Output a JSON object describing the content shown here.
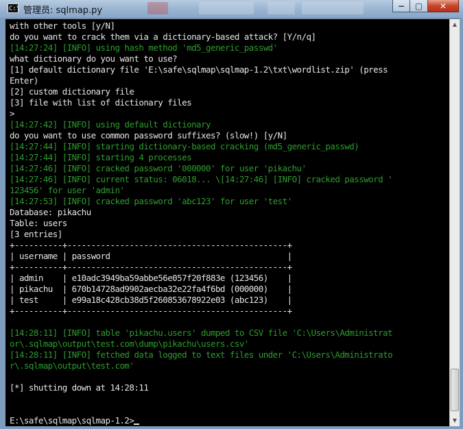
{
  "window": {
    "title": "管理员: sqlmap.py",
    "icon_name": "cmd-console-icon",
    "icon_glyph": "C:\\",
    "buttons": {
      "minimize": "−",
      "maximize": "▢",
      "close": "✕"
    }
  },
  "console": {
    "lines": [
      {
        "c": "w",
        "t": "with other tools [y/N]"
      },
      {
        "c": "w",
        "t": "do you want to crack them via a dictionary-based attack? [Y/n/q]"
      },
      {
        "c": "g",
        "t": "[14:27:24] [INFO] using hash method 'md5_generic_passwd'"
      },
      {
        "c": "w",
        "t": "what dictionary do you want to use?"
      },
      {
        "c": "w",
        "t": "[1] default dictionary file 'E:\\safe\\sqlmap\\sqlmap-1.2\\txt\\wordlist.zip' (press"
      },
      {
        "c": "w",
        "t": "Enter)"
      },
      {
        "c": "w",
        "t": "[2] custom dictionary file"
      },
      {
        "c": "w",
        "t": "[3] file with list of dictionary files"
      },
      {
        "c": "w",
        "t": ">"
      },
      {
        "c": "g",
        "t": "[14:27:42] [INFO] using default dictionary"
      },
      {
        "c": "w",
        "t": "do you want to use common password suffixes? (slow!) [y/N]"
      },
      {
        "c": "g",
        "t": "[14:27:44] [INFO] starting dictionary-based cracking (md5_generic_passwd)"
      },
      {
        "c": "g",
        "t": "[14:27:44] [INFO] starting 4 processes"
      },
      {
        "c": "g",
        "t": "[14:27:46] [INFO] cracked password '000000' for user 'pikachu'"
      },
      {
        "c": "g",
        "t": "[14:27:46] [INFO] current status: 06018... \\[14:27:46] [INFO] cracked password '"
      },
      {
        "c": "g",
        "t": "123456' for user 'admin'"
      },
      {
        "c": "g",
        "t": "[14:27:53] [INFO] cracked password 'abc123' for user 'test'"
      },
      {
        "c": "w",
        "t": "Database: pikachu"
      },
      {
        "c": "w",
        "t": "Table: users"
      },
      {
        "c": "w",
        "t": "[3 entries]"
      },
      {
        "c": "w",
        "t": "+----------+----------------------------------------------+"
      },
      {
        "c": "w",
        "t": "| username | password                                     |"
      },
      {
        "c": "w",
        "t": "+----------+----------------------------------------------+"
      },
      {
        "c": "w",
        "t": "| admin    | e10adc3949ba59abbe56e057f20f883e (123456)    |"
      },
      {
        "c": "w",
        "t": "| pikachu  | 670b14728ad9902aecba32e22fa4f6bd (000000)    |"
      },
      {
        "c": "w",
        "t": "| test     | e99a18c428cb38d5f260853678922e03 (abc123)    |"
      },
      {
        "c": "w",
        "t": "+----------+----------------------------------------------+"
      },
      {
        "c": "w",
        "t": ""
      },
      {
        "c": "g",
        "t": "[14:28:11] [INFO] table 'pikachu.users' dumped to CSV file 'C:\\Users\\Administrat"
      },
      {
        "c": "g",
        "t": "or\\.sqlmap\\output\\test.com\\dump\\pikachu\\users.csv'"
      },
      {
        "c": "g",
        "t": "[14:28:11] [INFO] fetched data logged to text files under 'C:\\Users\\Administrato"
      },
      {
        "c": "g",
        "t": "r\\.sqlmap\\output\\test.com'"
      },
      {
        "c": "w",
        "t": ""
      },
      {
        "c": "w",
        "t": "[*] shutting down at 14:28:11"
      },
      {
        "c": "w",
        "t": ""
      },
      {
        "c": "w",
        "t": ""
      },
      {
        "c": "w",
        "t": "E:\\safe\\sqlmap\\sqlmap-1.2>"
      }
    ],
    "colors": {
      "normal_text": "#e6e6e6",
      "info_text": "#2e9d2e",
      "background": "#000000"
    }
  },
  "scrollbar": {
    "up_icon": "▲",
    "down_icon": "▼"
  }
}
